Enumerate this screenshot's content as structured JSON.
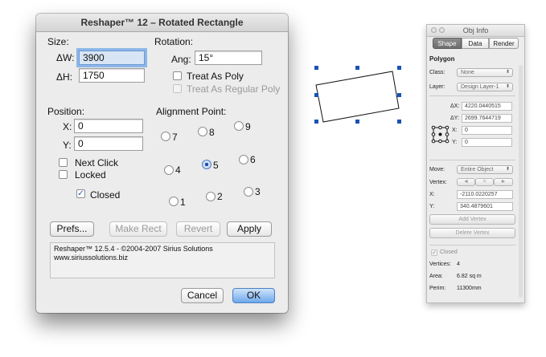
{
  "dialog": {
    "title": "Reshaper™ 12 – Rotated Rectangle",
    "size_label": "Size:",
    "dw_label": "ΔW:",
    "dw_value": "3900",
    "dh_label": "ΔH:",
    "dh_value": "1750",
    "rotation_label": "Rotation:",
    "ang_label": "Ang:",
    "ang_value": "15°",
    "treat_as_poly": "Treat As Poly",
    "treat_as_regular_poly": "Treat As Regular Poly",
    "position_label": "Position:",
    "x_label": "X:",
    "x_value": "0",
    "y_label": "Y:",
    "y_value": "0",
    "next_click": "Next Click",
    "locked": "Locked",
    "closed": "Closed",
    "alignment_label": "Alignment Point:",
    "alignment_points": [
      "7",
      "8",
      "9",
      "4",
      "5",
      "6",
      "1",
      "2",
      "3"
    ],
    "alignment_selected": "5",
    "prefs_button": "Prefs...",
    "make_rect_button": "Make Rect",
    "revert_button": "Revert",
    "apply_button": "Apply",
    "info_line1": "Reshaper™ 12.5.4 - ©2004-2007 Sirius Solutions",
    "info_line2": "www.siriussolutions.biz",
    "cancel_button": "Cancel",
    "ok_button": "OK"
  },
  "obj_info": {
    "title": "Obj Info",
    "tabs": [
      "Shape",
      "Data",
      "Render"
    ],
    "active_tab": "Shape",
    "object_type": "Polygon",
    "class_label": "Class:",
    "class_value": "None",
    "layer_label": "Layer:",
    "layer_value": "Design Layer-1",
    "dx_label": "ΔX:",
    "dx_value": "4220.0440515",
    "dy_label": "ΔY:",
    "dy_value": "2699.7644719",
    "x_label": "X:",
    "x_value": "0",
    "y_label": "Y:",
    "y_value": "0",
    "move_label": "Move:",
    "move_value": "Entire Object",
    "vertex_label": "Vertex:",
    "vertex_nav": [
      "◄",
      "=",
      "►"
    ],
    "vx_label": "X:",
    "vx_value": "-2110.0220257",
    "vy_label": "Y:",
    "vy_value": "340.4879601",
    "add_vertex": "Add Vertex",
    "delete_vertex": "Delete Vertex",
    "closed_label": "Closed",
    "vertices_label": "Vertices:",
    "vertices_value": "4",
    "area_label": "Area:",
    "area_value": "6.82 sq m",
    "perim_label": "Perim:",
    "perim_value": "11300mm"
  },
  "colors": {
    "selection_handle": "#1a52b6",
    "default_button": "#6ea8ec",
    "focus_ring": "#8cb7e8"
  }
}
